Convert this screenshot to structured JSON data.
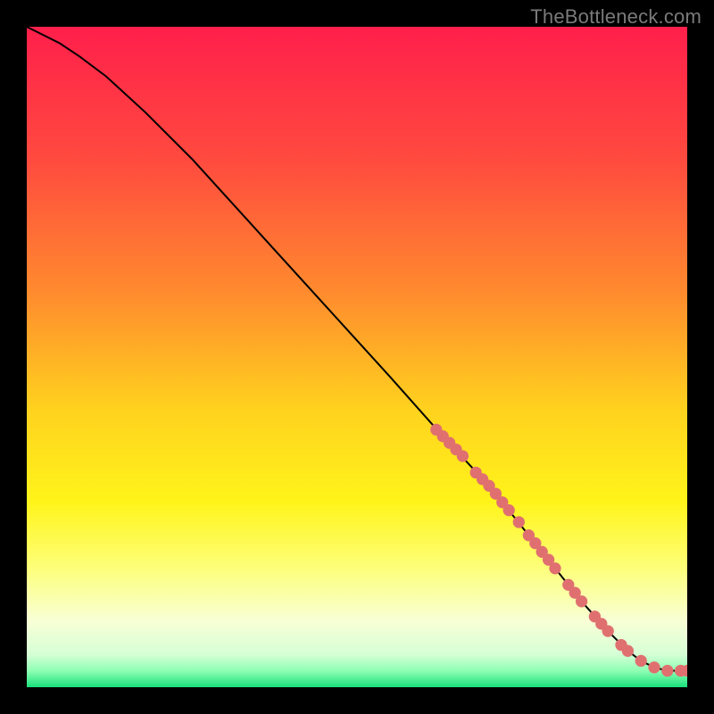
{
  "watermark": "TheBottleneck.com",
  "chart_data": {
    "type": "line",
    "title": "",
    "xlabel": "",
    "ylabel": "",
    "xlim": [
      0,
      100
    ],
    "ylim": [
      0,
      100
    ],
    "grid": false,
    "legend": false,
    "background_gradient_stops": [
      {
        "offset": 0.0,
        "color": "#ff1f4b"
      },
      {
        "offset": 0.2,
        "color": "#ff4a3f"
      },
      {
        "offset": 0.4,
        "color": "#ff8a2e"
      },
      {
        "offset": 0.58,
        "color": "#ffd21e"
      },
      {
        "offset": 0.72,
        "color": "#fff41a"
      },
      {
        "offset": 0.82,
        "color": "#fdff7a"
      },
      {
        "offset": 0.9,
        "color": "#f8ffd6"
      },
      {
        "offset": 0.95,
        "color": "#d6ffd6"
      },
      {
        "offset": 0.975,
        "color": "#8fffb4"
      },
      {
        "offset": 1.0,
        "color": "#18e07a"
      }
    ],
    "series": [
      {
        "name": "curve",
        "color": "#000000",
        "x": [
          0,
          2,
          5,
          8,
          12,
          18,
          25,
          35,
          45,
          55,
          63,
          70,
          76,
          80,
          84,
          88,
          91,
          93,
          95,
          97,
          100
        ],
        "y": [
          100,
          99,
          97.5,
          95.5,
          92.5,
          87,
          80,
          69,
          58,
          47,
          38,
          30.5,
          23,
          18,
          13,
          8.5,
          5.5,
          4,
          3,
          2.5,
          2.5
        ]
      }
    ],
    "highlight_points": {
      "color": "#e07070",
      "radius": 0.9,
      "points": [
        {
          "x": 62,
          "y": 39
        },
        {
          "x": 63,
          "y": 38
        },
        {
          "x": 64,
          "y": 37
        },
        {
          "x": 65,
          "y": 36
        },
        {
          "x": 66,
          "y": 35
        },
        {
          "x": 68,
          "y": 32.5
        },
        {
          "x": 69,
          "y": 31.5
        },
        {
          "x": 70,
          "y": 30.5
        },
        {
          "x": 71,
          "y": 29.3
        },
        {
          "x": 72,
          "y": 28
        },
        {
          "x": 73,
          "y": 26.8
        },
        {
          "x": 74.5,
          "y": 25
        },
        {
          "x": 76,
          "y": 23
        },
        {
          "x": 77,
          "y": 21.8
        },
        {
          "x": 78,
          "y": 20.5
        },
        {
          "x": 79,
          "y": 19.3
        },
        {
          "x": 80,
          "y": 18
        },
        {
          "x": 82,
          "y": 15.5
        },
        {
          "x": 83,
          "y": 14.3
        },
        {
          "x": 84,
          "y": 13
        },
        {
          "x": 86,
          "y": 10.7
        },
        {
          "x": 87,
          "y": 9.6
        },
        {
          "x": 88,
          "y": 8.5
        },
        {
          "x": 90,
          "y": 6.4
        },
        {
          "x": 91,
          "y": 5.5
        },
        {
          "x": 93,
          "y": 4
        },
        {
          "x": 95,
          "y": 3
        },
        {
          "x": 97,
          "y": 2.5
        },
        {
          "x": 99,
          "y": 2.5
        },
        {
          "x": 100,
          "y": 2.5
        }
      ]
    }
  }
}
